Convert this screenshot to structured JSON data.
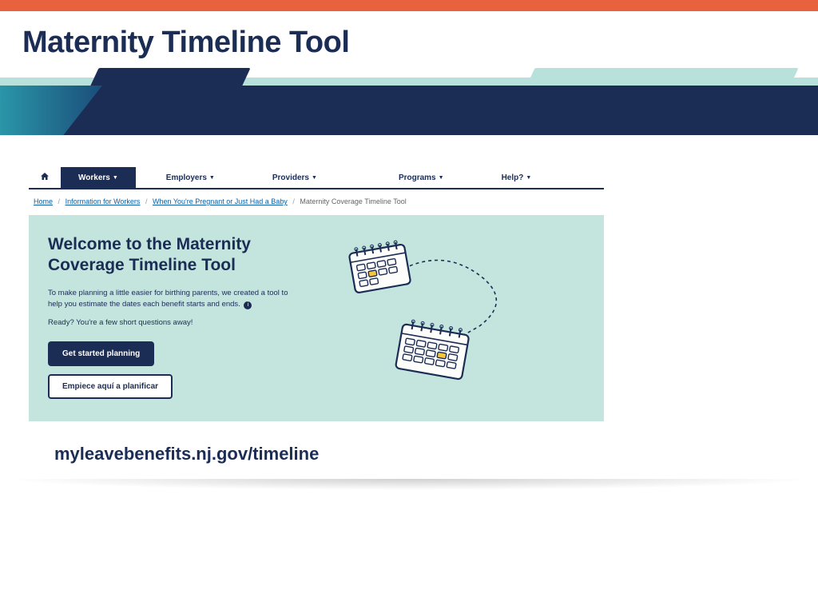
{
  "slide": {
    "title": "Maternity Timeline Tool"
  },
  "nav": {
    "items": [
      {
        "label": "Workers",
        "active": true
      },
      {
        "label": "Employers"
      },
      {
        "label": "Providers"
      },
      {
        "label": "Programs"
      },
      {
        "label": "Help?"
      }
    ]
  },
  "breadcrumb": {
    "items": [
      "Home",
      "Information for Workers",
      "When You're Pregnant or Just Had a Baby"
    ],
    "current": "Maternity Coverage Timeline Tool"
  },
  "hero": {
    "title": "Welcome to the Maternity Coverage Timeline Tool",
    "desc": "To make planning a little easier for birthing parents, we created a tool to help you estimate the dates each benefit starts and ends.",
    "ready": "Ready? You're a few short questions away!",
    "cta_primary": "Get started planning",
    "cta_secondary": "Empiece aquí a planificar"
  },
  "url": "myleavebenefits.nj.gov/timeline"
}
